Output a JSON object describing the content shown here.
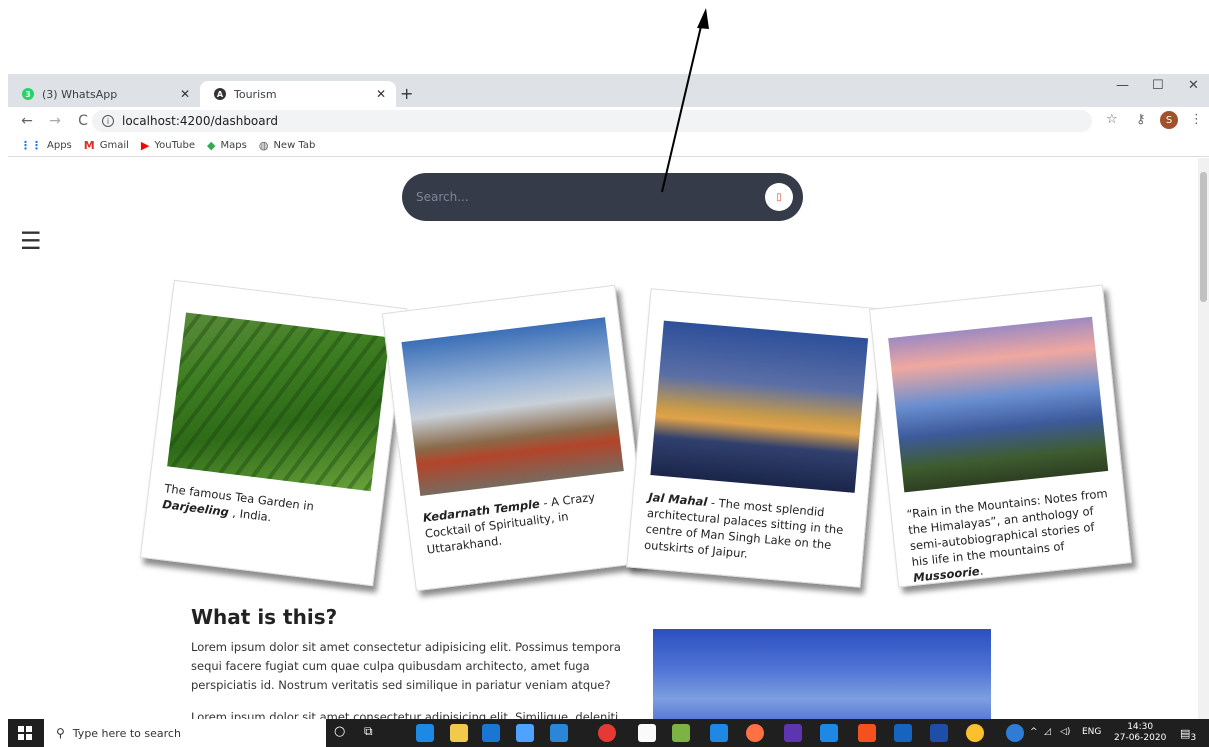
{
  "browser": {
    "tabs": [
      {
        "label": "(3) WhatsApp",
        "favicon_color": "#25d366"
      },
      {
        "label": "Tourism",
        "favicon_color": "#333333"
      }
    ],
    "url": "localhost:4200/dashboard",
    "profile_initial": "S",
    "bookmarks": [
      {
        "label": "Apps",
        "icon": "apps-grid-icon"
      },
      {
        "label": "Gmail",
        "icon": "gmail-icon"
      },
      {
        "label": "YouTube",
        "icon": "youtube-icon"
      },
      {
        "label": "Maps",
        "icon": "maps-icon"
      },
      {
        "label": "New Tab",
        "icon": "globe-icon"
      }
    ]
  },
  "search": {
    "placeholder": "Search..."
  },
  "cards": [
    {
      "caption_pre": "The famous Tea Garden in ",
      "caption_bold": "Darjeeling",
      "caption_post": " , India."
    },
    {
      "caption_pre": "",
      "caption_bold": "Kedarnath Temple",
      "caption_post": " - A Crazy Cocktail of Spirituality, in Uttarakhand."
    },
    {
      "caption_pre": "",
      "caption_bold": "Jal Mahal",
      "caption_post": " - The most splendid architectural palaces sitting in the centre of Man Singh Lake on the outskirts of Jaipur."
    },
    {
      "caption_pre": "“Rain in the Mountains: Notes from the Himalayas”, an anthology of semi-autobiographical stories of his life in the mountains of ",
      "caption_bold": "Mussoorie",
      "caption_post": "."
    }
  ],
  "about": {
    "title": "What is this?",
    "paragraph1": "Lorem ipsum dolor sit amet consectetur adipisicing elit. Possimus tempora sequi facere fugiat cum quae culpa quibusdam architecto, amet fuga perspiciatis id. Nostrum veritatis sed similique in pariatur veniam atque?",
    "paragraph2": "Lorem ipsum dolor sit amet consectetur adipisicing elit. Similique, deleniti id"
  },
  "taskbar": {
    "search_placeholder": "Type here to search",
    "language": "ENG",
    "time": "14:30",
    "date": "27-06-2020",
    "notification_count": "3"
  }
}
